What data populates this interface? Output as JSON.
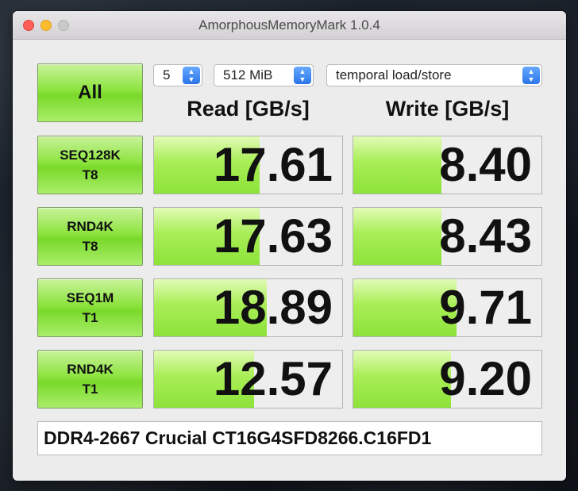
{
  "window": {
    "title": "AmorphousMemoryMark 1.0.4"
  },
  "controls": {
    "all_label": "All",
    "count": "5",
    "size": "512 MiB",
    "mode": "temporal load/store"
  },
  "headers": {
    "read": "Read [GB/s]",
    "write": "Write [GB/s]"
  },
  "tests": [
    {
      "line1": "SEQ128K",
      "line2": "T8",
      "read": "17.61",
      "read_level": 0.56,
      "write": "8.40",
      "write_level": 0.47
    },
    {
      "line1": "RND4K",
      "line2": "T8",
      "read": "17.63",
      "read_level": 0.56,
      "write": "8.43",
      "write_level": 0.47
    },
    {
      "line1": "SEQ1M",
      "line2": "T1",
      "read": "18.89",
      "read_level": 0.6,
      "write": "9.71",
      "write_level": 0.55
    },
    {
      "line1": "RND4K",
      "line2": "T1",
      "read": "12.57",
      "read_level": 0.53,
      "write": "9.20",
      "write_level": 0.52
    }
  ],
  "comment": "DDR4-2667 Crucial CT16G4SFD8266.C16FD1",
  "colors": {
    "accent_green": "#8de33a",
    "select_blue": "#2b75e9",
    "close": "#ff5f57",
    "minimize": "#febc2e"
  }
}
